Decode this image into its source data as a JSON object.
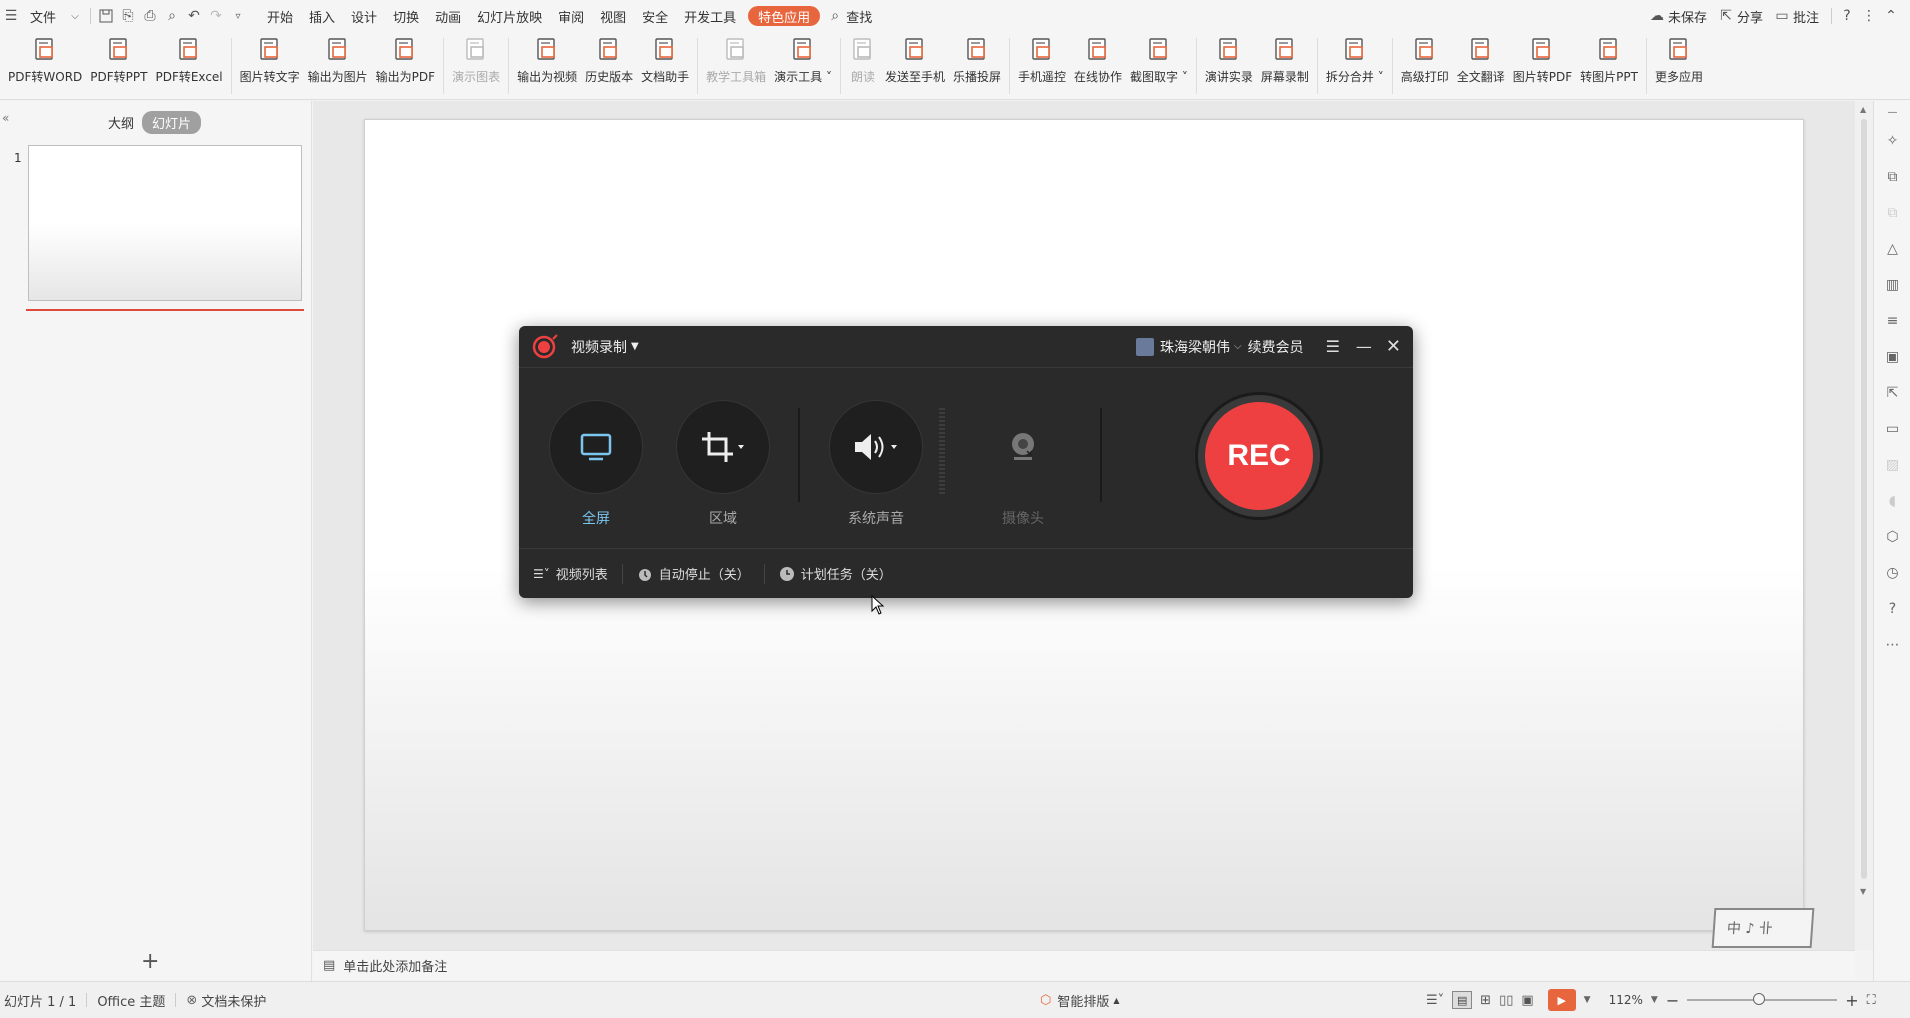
{
  "menubar": {
    "file": "文件",
    "tabs": [
      "开始",
      "插入",
      "设计",
      "切换",
      "动画",
      "幻灯片放映",
      "审阅",
      "视图",
      "安全",
      "开发工具"
    ],
    "special": "特色应用",
    "search": "查找",
    "unsaved": "未保存",
    "share": "分享",
    "comment": "批注"
  },
  "ribbon": {
    "buttons": [
      {
        "label": "PDF转WORD",
        "icon": "pdf-word-icon",
        "enabled": true
      },
      {
        "label": "PDF转PPT",
        "icon": "pdf-ppt-icon",
        "enabled": true
      },
      {
        "label": "PDF转Excel",
        "icon": "pdf-excel-icon",
        "enabled": true
      },
      {
        "label": "图片转文字",
        "icon": "image-to-text-icon",
        "enabled": true
      },
      {
        "label": "输出为图片",
        "icon": "export-image-icon",
        "enabled": true
      },
      {
        "label": "输出为PDF",
        "icon": "export-pdf-icon",
        "enabled": true
      },
      {
        "label": "演示图表",
        "icon": "chart-icon",
        "enabled": false
      },
      {
        "label": "输出为视频",
        "icon": "export-video-icon",
        "enabled": true
      },
      {
        "label": "历史版本",
        "icon": "history-icon",
        "enabled": true
      },
      {
        "label": "文档助手",
        "icon": "doc-assistant-icon",
        "enabled": true
      },
      {
        "label": "教学工具箱",
        "icon": "teaching-tools-icon",
        "enabled": false
      },
      {
        "label": "演示工具",
        "icon": "present-tools-icon",
        "enabled": true,
        "dropdown": true
      },
      {
        "label": "朗读",
        "icon": "read-aloud-icon",
        "enabled": false
      },
      {
        "label": "发送至手机",
        "icon": "send-phone-icon",
        "enabled": true
      },
      {
        "label": "乐播投屏",
        "icon": "cast-icon",
        "enabled": true
      },
      {
        "label": "手机遥控",
        "icon": "remote-icon",
        "enabled": true
      },
      {
        "label": "在线协作",
        "icon": "collab-icon",
        "enabled": true
      },
      {
        "label": "截图取字",
        "icon": "ocr-icon",
        "enabled": true,
        "dropdown": true
      },
      {
        "label": "演讲实录",
        "icon": "lecture-record-icon",
        "enabled": true
      },
      {
        "label": "屏幕录制",
        "icon": "screen-record-icon",
        "enabled": true
      },
      {
        "label": "拆分合并",
        "icon": "split-merge-icon",
        "enabled": true,
        "dropdown": true
      },
      {
        "label": "高级打印",
        "icon": "print-icon",
        "enabled": true
      },
      {
        "label": "全文翻译",
        "icon": "translate-icon",
        "enabled": true
      },
      {
        "label": "图片转PDF",
        "icon": "image-pdf-icon",
        "enabled": true
      },
      {
        "label": "转图片PPT",
        "icon": "image-ppt-icon",
        "enabled": true
      },
      {
        "label": "更多应用",
        "icon": "more-apps-icon",
        "enabled": true
      }
    ]
  },
  "left_panel": {
    "tab_outline": "大纲",
    "tab_slides": "幻灯片",
    "slide_number": "1"
  },
  "notes": {
    "placeholder": "单击此处添加备注"
  },
  "recorder": {
    "mode": "视频录制",
    "user": "珠海梁朝伟",
    "vip": "续费会员",
    "controls": [
      {
        "label": "全屏",
        "icon": "monitor-icon",
        "active": true
      },
      {
        "label": "区域",
        "icon": "crop-icon",
        "active": false
      },
      {
        "label": "系统声音",
        "icon": "speaker-icon",
        "active": false
      },
      {
        "label": "摄像头",
        "icon": "webcam-icon",
        "active": false
      }
    ],
    "rec": "REC",
    "footer": {
      "video_list": "视频列表",
      "auto_stop": "自动停止（关）",
      "schedule": "计划任务（关）"
    },
    "accent": "#ee4040"
  },
  "statusbar": {
    "slide_info": "幻灯片 1 / 1",
    "theme": "Office 主题",
    "protect": "文档未保护",
    "smart_layout": "智能排版",
    "zoom": "112%"
  },
  "colors": {
    "special_tab": "#e8663d",
    "rec_red": "#ee4040",
    "play_button": "#e8663d"
  }
}
